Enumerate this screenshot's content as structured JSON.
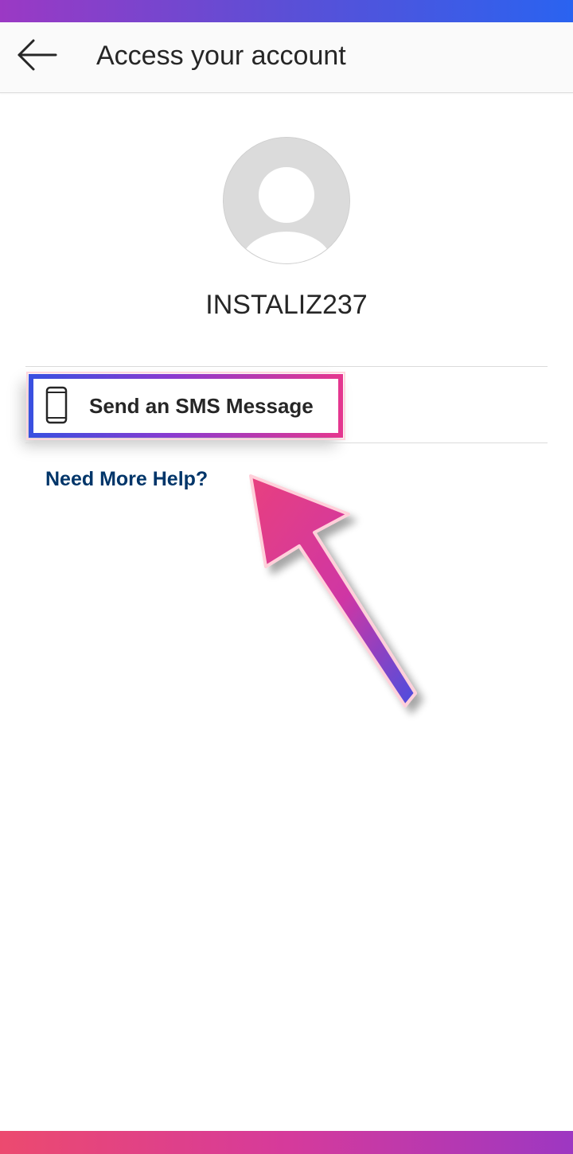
{
  "header": {
    "title": "Access your account",
    "back_icon": "arrow-left-icon"
  },
  "profile": {
    "avatar_icon": "default-avatar-icon",
    "username": "INSTALIZ237"
  },
  "options": {
    "sms": {
      "icon": "mobile-phone-icon",
      "label": "Send an SMS Message"
    }
  },
  "help": {
    "link_label": "Need More Help?"
  },
  "annotation": {
    "arrow_icon": "annotation-arrow-icon",
    "highlight": "highlight-box"
  },
  "colors": {
    "link": "#003569",
    "text": "#262626",
    "divider": "#dbdbdb",
    "header_bg": "#fafafa",
    "accent_pink": "#e4378f",
    "accent_blue": "#3a4fe0",
    "accent_purple": "#8a3ad0"
  }
}
